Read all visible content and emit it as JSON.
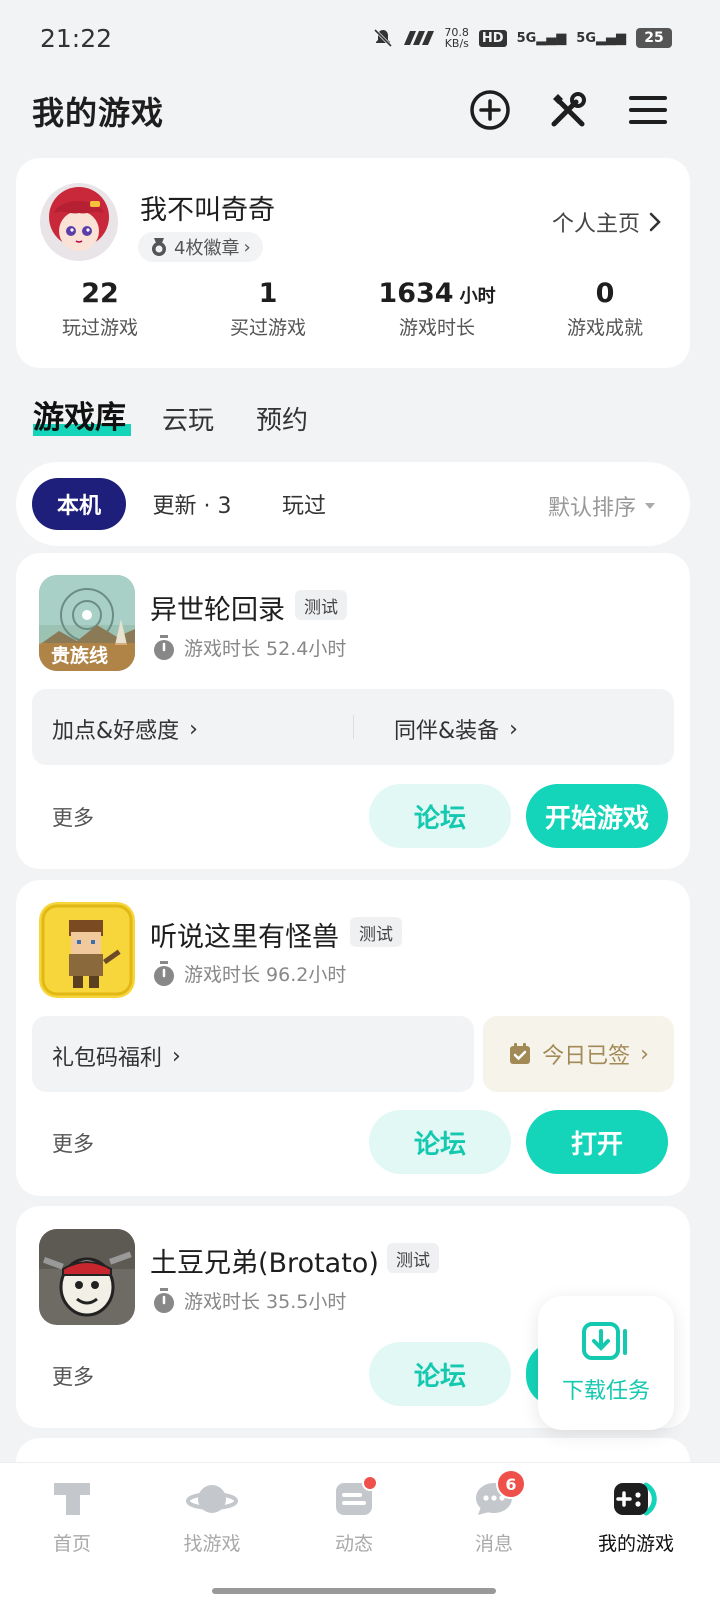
{
  "status_bar": {
    "time": "21:22",
    "net_speed": "70.8",
    "net_unit": "KB/s",
    "hd": "HD",
    "sig1": "5G",
    "sig2": "5G",
    "battery": "25"
  },
  "header": {
    "title": "我的游戏"
  },
  "profile": {
    "username": "我不叫奇奇",
    "badges": "4枚徽章",
    "profile_link": "个人主页",
    "stats": [
      {
        "value": "22",
        "unit": "",
        "label": "玩过游戏"
      },
      {
        "value": "1",
        "unit": "",
        "label": "买过游戏"
      },
      {
        "value": "1634",
        "unit": "小时",
        "label": "游戏时长"
      },
      {
        "value": "0",
        "unit": "",
        "label": "游戏成就"
      }
    ]
  },
  "tabs": [
    "游戏库",
    "云玩",
    "预约"
  ],
  "filters": {
    "chips": [
      "本机",
      "更新 · 3",
      "玩过"
    ],
    "sort": "默认排序"
  },
  "games": [
    {
      "name": "异世轮回录",
      "tag": "测试",
      "playtime": "游戏时长 52.4小时",
      "shortcuts": [
        "加点&好感度",
        "同伴&装备"
      ],
      "icon_text": "贵族线",
      "more": "更多",
      "forum": "论坛",
      "action": "开始游戏"
    },
    {
      "name": "听说这里有怪兽",
      "tag": "测试",
      "playtime": "游戏时长 96.2小时",
      "shortcuts": [
        "礼包码福利"
      ],
      "signin": "今日已签",
      "more": "更多",
      "forum": "论坛",
      "action": "打开"
    },
    {
      "name": "土豆兄弟(Brotato)",
      "tag": "测试",
      "playtime": "游戏时长 35.5小时",
      "more": "更多",
      "forum": "论坛"
    }
  ],
  "fab": {
    "label": "下载任务"
  },
  "bottom_nav": {
    "items": [
      {
        "label": "首页",
        "icon": "home-t-icon"
      },
      {
        "label": "找游戏",
        "icon": "planet-icon"
      },
      {
        "label": "动态",
        "icon": "feed-icon"
      },
      {
        "label": "消息",
        "icon": "chat-icon",
        "badge": "6"
      },
      {
        "label": "我的游戏",
        "icon": "gamepad-icon"
      }
    ]
  },
  "colors": {
    "accent": "#14d4b9",
    "chip_active": "#1d1f7a",
    "badge_red": "#f0504a"
  }
}
